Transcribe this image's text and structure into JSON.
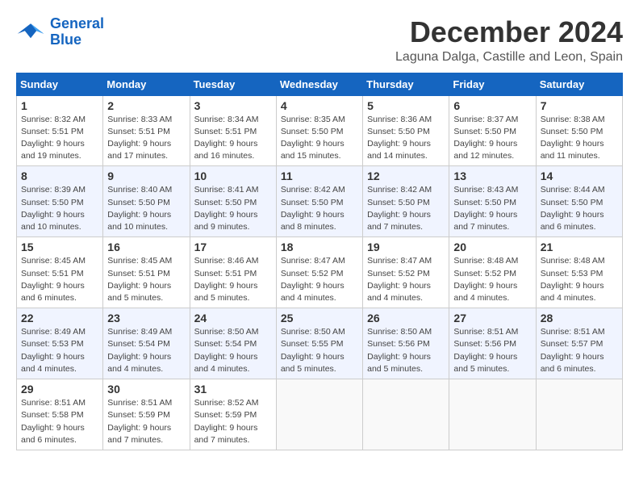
{
  "logo": {
    "line1": "General",
    "line2": "Blue"
  },
  "title": "December 2024",
  "subtitle": "Laguna Dalga, Castille and Leon, Spain",
  "headers": [
    "Sunday",
    "Monday",
    "Tuesday",
    "Wednesday",
    "Thursday",
    "Friday",
    "Saturday"
  ],
  "weeks": [
    [
      {
        "day": "1",
        "sunrise": "8:32 AM",
        "sunset": "5:51 PM",
        "daylight": "9 hours and 19 minutes."
      },
      {
        "day": "2",
        "sunrise": "8:33 AM",
        "sunset": "5:51 PM",
        "daylight": "9 hours and 17 minutes."
      },
      {
        "day": "3",
        "sunrise": "8:34 AM",
        "sunset": "5:51 PM",
        "daylight": "9 hours and 16 minutes."
      },
      {
        "day": "4",
        "sunrise": "8:35 AM",
        "sunset": "5:50 PM",
        "daylight": "9 hours and 15 minutes."
      },
      {
        "day": "5",
        "sunrise": "8:36 AM",
        "sunset": "5:50 PM",
        "daylight": "9 hours and 14 minutes."
      },
      {
        "day": "6",
        "sunrise": "8:37 AM",
        "sunset": "5:50 PM",
        "daylight": "9 hours and 12 minutes."
      },
      {
        "day": "7",
        "sunrise": "8:38 AM",
        "sunset": "5:50 PM",
        "daylight": "9 hours and 11 minutes."
      }
    ],
    [
      {
        "day": "8",
        "sunrise": "8:39 AM",
        "sunset": "5:50 PM",
        "daylight": "9 hours and 10 minutes."
      },
      {
        "day": "9",
        "sunrise": "8:40 AM",
        "sunset": "5:50 PM",
        "daylight": "9 hours and 10 minutes."
      },
      {
        "day": "10",
        "sunrise": "8:41 AM",
        "sunset": "5:50 PM",
        "daylight": "9 hours and 9 minutes."
      },
      {
        "day": "11",
        "sunrise": "8:42 AM",
        "sunset": "5:50 PM",
        "daylight": "9 hours and 8 minutes."
      },
      {
        "day": "12",
        "sunrise": "8:42 AM",
        "sunset": "5:50 PM",
        "daylight": "9 hours and 7 minutes."
      },
      {
        "day": "13",
        "sunrise": "8:43 AM",
        "sunset": "5:50 PM",
        "daylight": "9 hours and 7 minutes."
      },
      {
        "day": "14",
        "sunrise": "8:44 AM",
        "sunset": "5:50 PM",
        "daylight": "9 hours and 6 minutes."
      }
    ],
    [
      {
        "day": "15",
        "sunrise": "8:45 AM",
        "sunset": "5:51 PM",
        "daylight": "9 hours and 6 minutes."
      },
      {
        "day": "16",
        "sunrise": "8:45 AM",
        "sunset": "5:51 PM",
        "daylight": "9 hours and 5 minutes."
      },
      {
        "day": "17",
        "sunrise": "8:46 AM",
        "sunset": "5:51 PM",
        "daylight": "9 hours and 5 minutes."
      },
      {
        "day": "18",
        "sunrise": "8:47 AM",
        "sunset": "5:52 PM",
        "daylight": "9 hours and 4 minutes."
      },
      {
        "day": "19",
        "sunrise": "8:47 AM",
        "sunset": "5:52 PM",
        "daylight": "9 hours and 4 minutes."
      },
      {
        "day": "20",
        "sunrise": "8:48 AM",
        "sunset": "5:52 PM",
        "daylight": "9 hours and 4 minutes."
      },
      {
        "day": "21",
        "sunrise": "8:48 AM",
        "sunset": "5:53 PM",
        "daylight": "9 hours and 4 minutes."
      }
    ],
    [
      {
        "day": "22",
        "sunrise": "8:49 AM",
        "sunset": "5:53 PM",
        "daylight": "9 hours and 4 minutes."
      },
      {
        "day": "23",
        "sunrise": "8:49 AM",
        "sunset": "5:54 PM",
        "daylight": "9 hours and 4 minutes."
      },
      {
        "day": "24",
        "sunrise": "8:50 AM",
        "sunset": "5:54 PM",
        "daylight": "9 hours and 4 minutes."
      },
      {
        "day": "25",
        "sunrise": "8:50 AM",
        "sunset": "5:55 PM",
        "daylight": "9 hours and 5 minutes."
      },
      {
        "day": "26",
        "sunrise": "8:50 AM",
        "sunset": "5:56 PM",
        "daylight": "9 hours and 5 minutes."
      },
      {
        "day": "27",
        "sunrise": "8:51 AM",
        "sunset": "5:56 PM",
        "daylight": "9 hours and 5 minutes."
      },
      {
        "day": "28",
        "sunrise": "8:51 AM",
        "sunset": "5:57 PM",
        "daylight": "9 hours and 6 minutes."
      }
    ],
    [
      {
        "day": "29",
        "sunrise": "8:51 AM",
        "sunset": "5:58 PM",
        "daylight": "9 hours and 6 minutes."
      },
      {
        "day": "30",
        "sunrise": "8:51 AM",
        "sunset": "5:59 PM",
        "daylight": "9 hours and 7 minutes."
      },
      {
        "day": "31",
        "sunrise": "8:52 AM",
        "sunset": "5:59 PM",
        "daylight": "9 hours and 7 minutes."
      },
      null,
      null,
      null,
      null
    ]
  ]
}
